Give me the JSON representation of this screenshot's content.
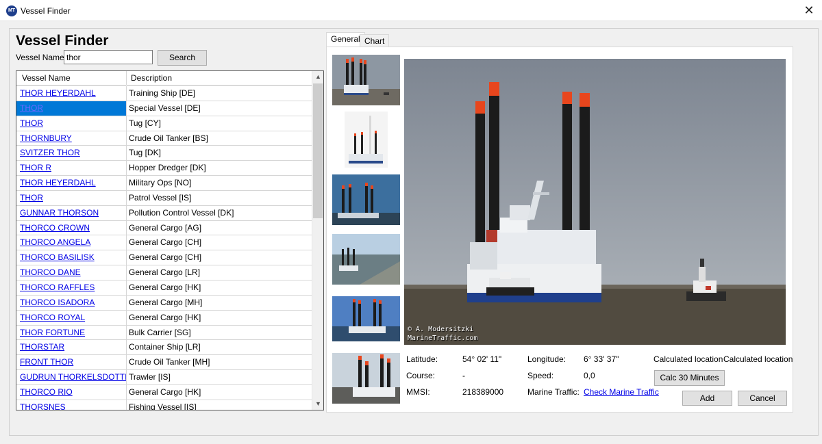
{
  "window": {
    "title": "Vessel Finder",
    "icon_text": "MT"
  },
  "header": {
    "title": "Vessel Finder",
    "name_label": "Vessel Name:",
    "search_value": "thor",
    "search_button": "Search"
  },
  "grid": {
    "columns": [
      "Vessel Name",
      "Description"
    ],
    "rows": [
      {
        "name": "THOR HEYERDAHL",
        "description": "Training Ship [DE]"
      },
      {
        "name": "THOR",
        "description": "Special Vessel [DE]"
      },
      {
        "name": "THOR",
        "description": "Tug [CY]"
      },
      {
        "name": "THORNBURY",
        "description": "Crude Oil Tanker [BS]"
      },
      {
        "name": "SVITZER THOR",
        "description": "Tug [DK]"
      },
      {
        "name": "THOR R",
        "description": "Hopper Dredger [DK]"
      },
      {
        "name": "THOR HEYERDAHL",
        "description": "Military Ops [NO]"
      },
      {
        "name": "THOR",
        "description": "Patrol Vessel [IS]"
      },
      {
        "name": "GUNNAR THORSON",
        "description": "Pollution Control Vessel [DK]"
      },
      {
        "name": "THORCO CROWN",
        "description": "General Cargo [AG]"
      },
      {
        "name": "THORCO ANGELA",
        "description": "General Cargo [CH]"
      },
      {
        "name": "THORCO BASILISK",
        "description": "General Cargo [CH]"
      },
      {
        "name": "THORCO DANE",
        "description": "General Cargo [LR]"
      },
      {
        "name": "THORCO RAFFLES",
        "description": "General Cargo [HK]"
      },
      {
        "name": "THORCO ISADORA",
        "description": "General Cargo [MH]"
      },
      {
        "name": "THORCO ROYAL",
        "description": "General Cargo [HK]"
      },
      {
        "name": "THOR FORTUNE",
        "description": "Bulk Carrier [SG]"
      },
      {
        "name": "THORSTAR",
        "description": "Container Ship [LR]"
      },
      {
        "name": "FRONT THOR",
        "description": "Crude Oil Tanker [MH]"
      },
      {
        "name": "GUDRUN THORKELSDOTTIR",
        "description": "Trawler [IS]"
      },
      {
        "name": "THORCO RIO",
        "description": "General Cargo [HK]"
      },
      {
        "name": "THORSNES",
        "description": "Fishing Vessel [IS]"
      }
    ],
    "selected_index": 1
  },
  "tabs": {
    "general": "General",
    "chart": "Chart"
  },
  "photo": {
    "credit_line1": "© A. Modersitzki",
    "credit_line2": "MarineTraffic.com"
  },
  "details": {
    "latitude_label": "Latitude:",
    "latitude_value": "54° 02' 11\"",
    "longitude_label": "Longitude:",
    "longitude_value": "6° 33' 37\"",
    "calc_location_1": "Calculated location",
    "calc_location_2": "Calculated location",
    "course_label": "Course:",
    "course_value": "-",
    "speed_label": "Speed:",
    "speed_value": "0,0",
    "calc_button": "Calc 30 Minutes",
    "mmsi_label": "MMSI:",
    "mmsi_value": "218389000",
    "marine_traffic_label": "Marine Traffic:",
    "marine_traffic_link": "Check Marine Traffic"
  },
  "actions": {
    "add": "Add",
    "cancel": "Cancel"
  },
  "colors": {
    "selection": "#0078d7",
    "link": "#0000e6",
    "leg_top": "#e8461d",
    "leg": "#1b1b1b"
  }
}
